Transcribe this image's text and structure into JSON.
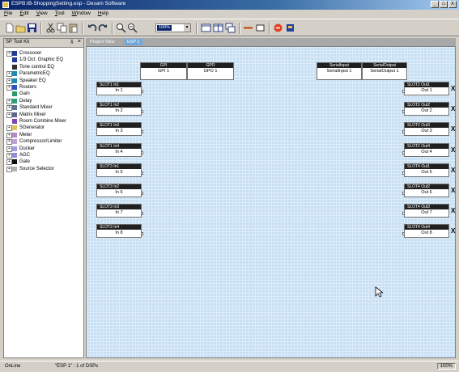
{
  "window": {
    "title": "ESPB:IB-ShoppingSetting.esp - Desam Software",
    "buttons": [
      "_",
      "□",
      "X"
    ]
  },
  "menu": [
    "File",
    "Edit",
    "View",
    "Tool",
    "Window",
    "Help"
  ],
  "toolbar": {
    "zoom_value": "100%"
  },
  "toolkit": {
    "title": "SP Tool Kit",
    "pin": "⊼",
    "close": "×",
    "items": [
      {
        "label": "Crossover",
        "color": "#1f3c9a",
        "expand": "+"
      },
      {
        "label": "1/3 Oct. Graphic EQ",
        "color": "#1f3c9a",
        "expand": ""
      },
      {
        "label": "Tone control EQ",
        "color": "#303030",
        "expand": ""
      },
      {
        "label": "ParametricEQ",
        "color": "#1e8ab0",
        "expand": "+"
      },
      {
        "label": "Speaker EQ",
        "color": "#1e8ab0",
        "expand": "+"
      },
      {
        "label": "Routers",
        "color": "#3050c0",
        "expand": "+"
      },
      {
        "label": "Gain",
        "color": "#2a9a6a",
        "expand": ""
      },
      {
        "label": "Delay",
        "color": "#28a070",
        "expand": "+"
      },
      {
        "label": "Standard Mixer",
        "color": "#607090",
        "expand": "+"
      },
      {
        "label": "Matrix Mixer",
        "color": "#5a6a8a",
        "expand": "+"
      },
      {
        "label": "Room Combine Mixer",
        "color": "#7a4ab0",
        "expand": ""
      },
      {
        "label": "SGenerator",
        "color": "#e0c060",
        "expand": "+"
      },
      {
        "label": "Meter",
        "color": "#b08cc0",
        "expand": "+"
      },
      {
        "label": "Compressor/Limiter",
        "color": "#c0a0d0",
        "expand": "+"
      },
      {
        "label": "Ducker",
        "color": "#a0a0e0",
        "expand": "+"
      },
      {
        "label": "AGC",
        "color": "#9090d0",
        "expand": "+"
      },
      {
        "label": "Gate",
        "color": "#101010",
        "expand": "+"
      },
      {
        "label": "Source Selector",
        "color": "#b0b0b0",
        "expand": "+"
      }
    ]
  },
  "tabs": [
    "Project View",
    "ESP 1"
  ],
  "canvas": {
    "gpi_gpo": [
      {
        "header": "GPI",
        "label": "GPI 1"
      },
      {
        "header": "GPO",
        "label": "GPO 1"
      }
    ],
    "serial": [
      {
        "header": "SerialInput",
        "label": "SerialInput 1"
      },
      {
        "header": "SerialOutput",
        "label": "SerialOutput 1"
      }
    ],
    "inputs": [
      {
        "header": "SLOT1   In1",
        "label": "In 1"
      },
      {
        "header": "SLOT1   In2",
        "label": "In 2"
      },
      {
        "header": "SLOT1   In3",
        "label": "In 3"
      },
      {
        "header": "SLOT1   In4",
        "label": "In 4"
      },
      {
        "header": "SLOT3   In1",
        "label": "In 5"
      },
      {
        "header": "SLOT3   In2",
        "label": "In 6"
      },
      {
        "header": "SLOT3   In3",
        "label": "In 7"
      },
      {
        "header": "SLOT3   In4",
        "label": "In 8"
      }
    ],
    "outputs": [
      {
        "header": "SLOT2   Out1",
        "label": "Out 1"
      },
      {
        "header": "SLOT2   Out2",
        "label": "Out 2"
      },
      {
        "header": "SLOT2   Out3",
        "label": "Out 3"
      },
      {
        "header": "SLOT2   Out4",
        "label": "Out 4"
      },
      {
        "header": "SLOT4   Out1",
        "label": "Out 5"
      },
      {
        "header": "SLOT4   Out2",
        "label": "Out 6"
      },
      {
        "header": "SLOT4   Out3",
        "label": "Out 7"
      },
      {
        "header": "SLOT4   Out4",
        "label": "Out 8"
      }
    ],
    "close_mark": "X"
  },
  "status": {
    "mode": "OnLine",
    "dsp": "\"ESP 1\" : 1 of DSPs",
    "zoom": "100%"
  }
}
